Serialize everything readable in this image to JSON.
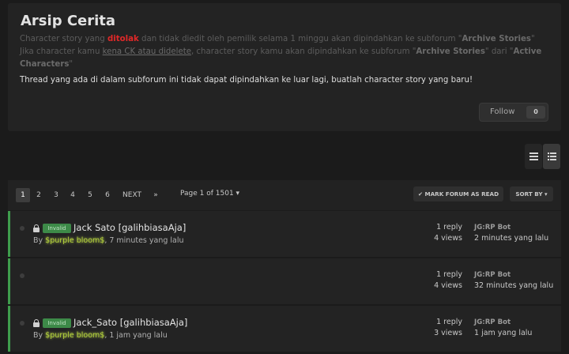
{
  "forum": {
    "title": "Arsip Cerita",
    "desc1_pre": "Character story yang ",
    "desc1_red": "ditolak",
    "desc1_mid": " dan tidak diedit oleh pemilik selama 1 minggu akan dipindahkan ke subforum \"",
    "desc1_bold": "Archive Stories",
    "desc1_end": "\"",
    "desc2_pre": "Jika character kamu ",
    "desc2_link": "kena CK atau didelete",
    "desc2_mid": ", character story kamu akan dipindahkan ke subforum \"",
    "desc2_bold1": "Archive Stories",
    "desc2_mid2": "\" dari \"",
    "desc2_bold2": "Active Characters",
    "desc2_end": "\"",
    "desc3": "Thread yang ada di dalam subforum ini tidak dapat dipindahkan ke luar lagi, buatlah character story yang baru!"
  },
  "follow": {
    "label": "Follow",
    "count": "0"
  },
  "pagination": {
    "pages": [
      "1",
      "2",
      "3",
      "4",
      "5",
      "6"
    ],
    "next": "NEXT",
    "last": "»",
    "page_info": "Page 1 of 1501 ▾"
  },
  "actions": {
    "mark_read": "✔ MARK FORUM AS READ",
    "sort_by": "SORT BY ▾"
  },
  "threads": [
    {
      "prefix": "Invalid",
      "title": "Jack Sato [galihbiasaAja]",
      "by": "By ",
      "author": "$purple bloom$",
      "time": ", 7 minutes yang lalu",
      "replies": "1 reply",
      "views": "4 views",
      "last_user": "JG:RP Bot",
      "last_time": "2 minutes yang lalu"
    },
    {
      "replies": "1 reply",
      "views": "4 views",
      "last_user": "JG:RP Bot",
      "last_time": "32 minutes yang lalu"
    },
    {
      "prefix": "Invalid",
      "title": "Jack_Sato [galihbiasaAja]",
      "by": "By ",
      "author": "$purple bloom$",
      "time": ", 1 jam yang lalu",
      "replies": "1 reply",
      "views": "3 views",
      "last_user": "JG:RP Bot",
      "last_time": "1 jam yang lalu"
    }
  ]
}
